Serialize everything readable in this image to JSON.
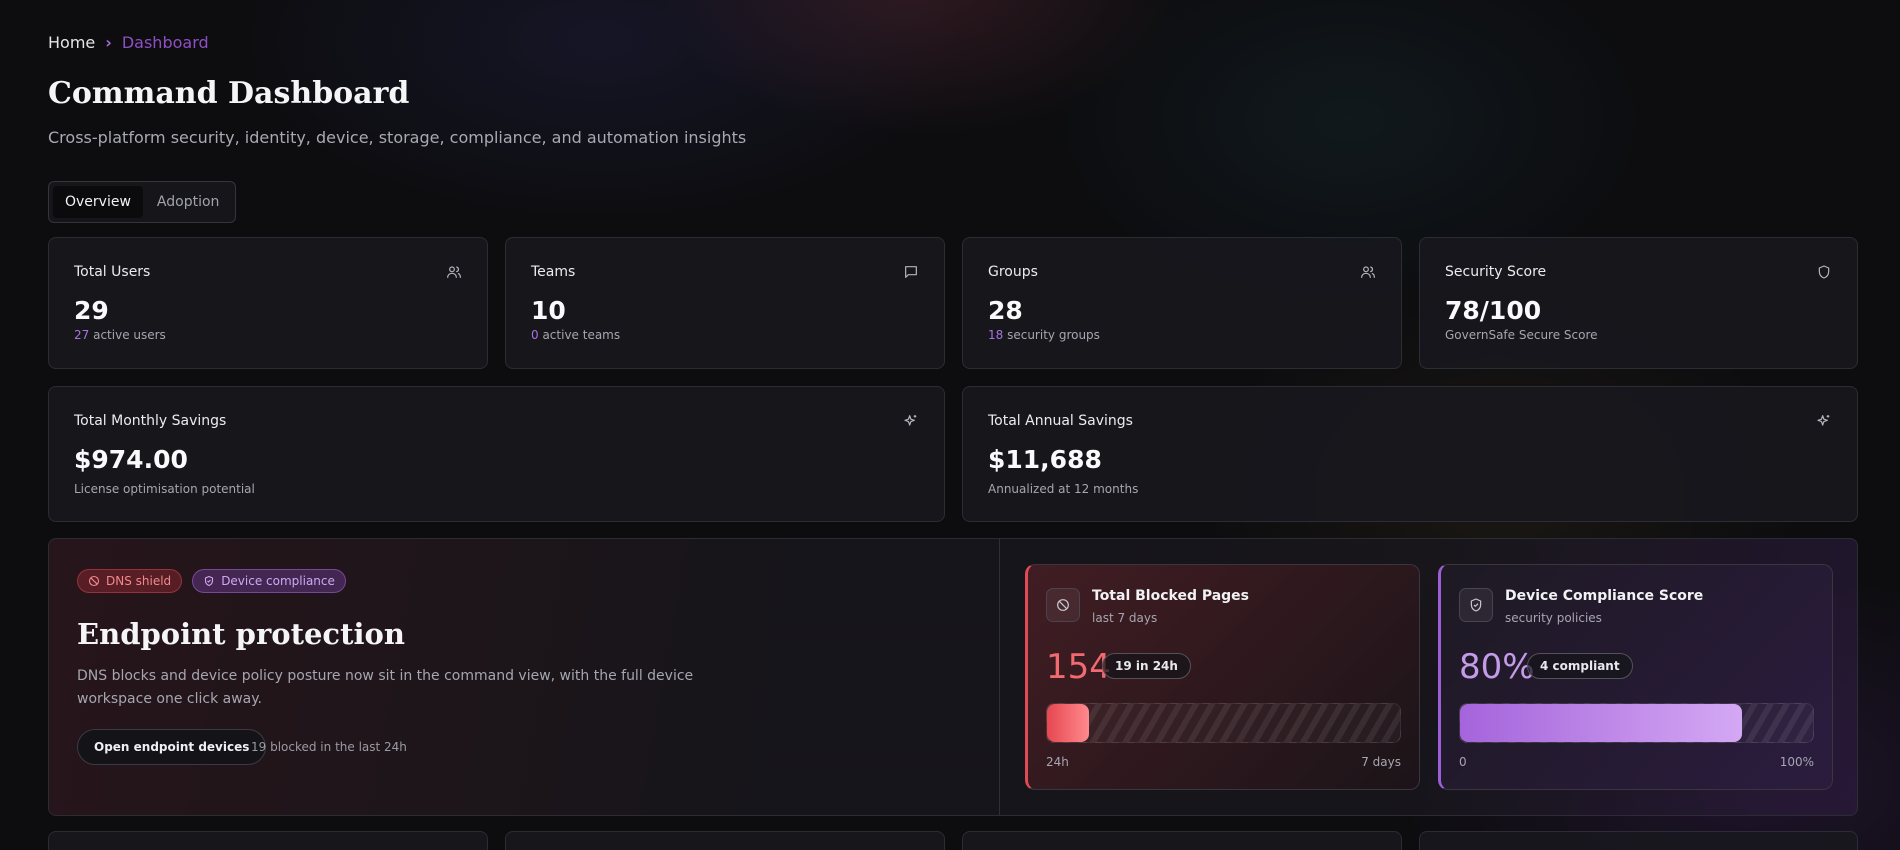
{
  "breadcrumb": {
    "home": "Home",
    "current": "Dashboard"
  },
  "header": {
    "title": "Command Dashboard",
    "subtitle": "Cross-platform security, identity, device, storage, compliance, and automation insights"
  },
  "tabs": [
    {
      "label": "Overview",
      "active": true
    },
    {
      "label": "Adoption",
      "active": false
    }
  ],
  "kpis": [
    {
      "title": "Total Users",
      "value": "29",
      "sub_num": "27",
      "sub_text": " active users",
      "icon": "users-icon"
    },
    {
      "title": "Teams",
      "value": "10",
      "sub_num": "0",
      "sub_text": " active teams",
      "icon": "chat-icon"
    },
    {
      "title": "Groups",
      "value": "28",
      "sub_num": "18",
      "sub_text": " security groups",
      "icon": "users-icon"
    },
    {
      "title": "Security Score",
      "value": "78/100",
      "sub_num": "",
      "sub_text": "GovernSafe Secure Score",
      "icon": "shield-icon"
    }
  ],
  "savings": [
    {
      "title": "Total Monthly Savings",
      "value": "$974.00",
      "sub": "License optimisation potential",
      "icon": "sparkles-icon"
    },
    {
      "title": "Total Annual Savings",
      "value": "$11,688",
      "sub": "Annualized at 12 months",
      "icon": "sparkles-icon"
    }
  ],
  "endpoint": {
    "badges": [
      "DNS shield",
      "Device compliance"
    ],
    "title": "Endpoint protection",
    "description": "DNS blocks and device policy posture now sit in the command view, with the full device workspace one click away.",
    "button_label": "Open endpoint devices",
    "note": "19 blocked in the last 24h"
  },
  "stats": {
    "blocked": {
      "title": "Total Blocked Pages",
      "sub": "last 7 days",
      "value": "154",
      "pill": "19 in 24h",
      "progress": 0.12,
      "range_lo": "24h",
      "range_hi": "7 days",
      "color": "#e6474f"
    },
    "compliance": {
      "title": "Device Compliance Score",
      "sub": "security policies",
      "value": "80%",
      "pill": "4 compliant",
      "progress": 0.8,
      "range_lo": "0",
      "range_hi": "100%",
      "color": "#a564db"
    }
  }
}
